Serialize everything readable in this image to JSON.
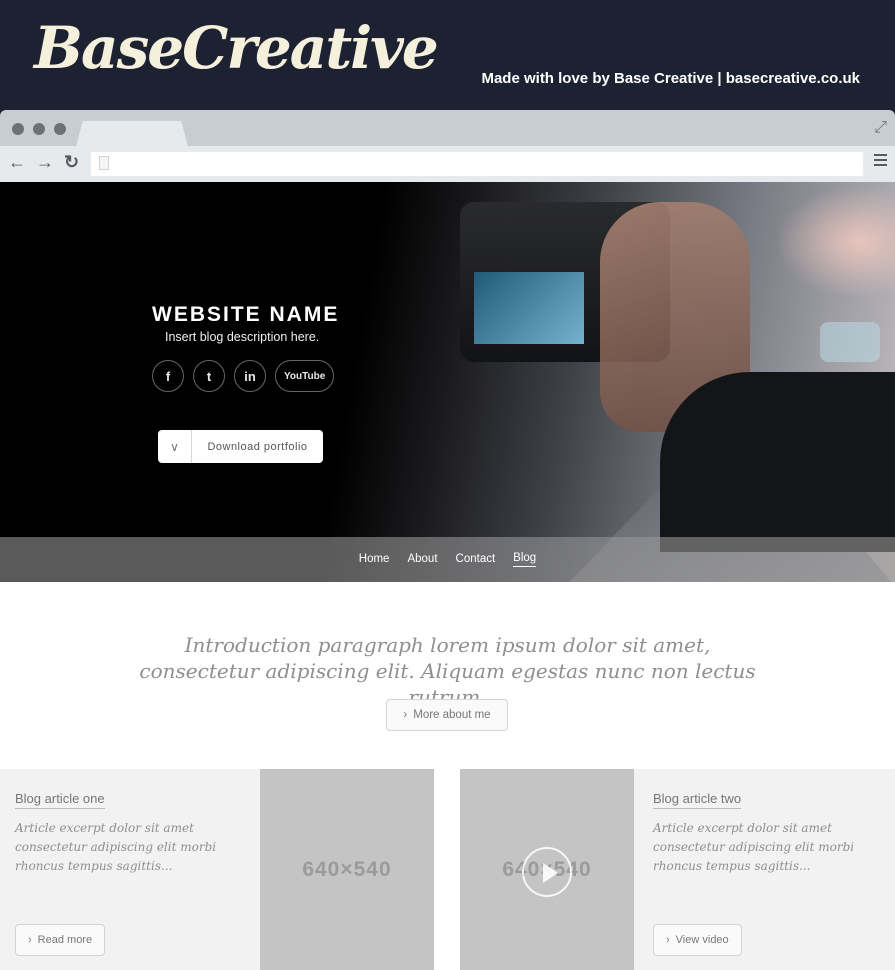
{
  "promo": {
    "logo": "BaseCreative",
    "tagline": "Made with love by Base Creative  |  basecreative.co.uk"
  },
  "browser": {
    "icons": [
      "back-arrow-icon",
      "forward-arrow-icon",
      "reload-icon",
      "page-icon",
      "menu-icon",
      "expand-icon"
    ]
  },
  "hero": {
    "title": "WEBSITE NAME",
    "description": "Insert blog description here.",
    "social": [
      "f",
      "t",
      "in",
      "YouTube"
    ],
    "download_label": "Download portfolio"
  },
  "nav": {
    "items": [
      "Home",
      "About",
      "Contact",
      "Blog"
    ],
    "active": "Blog"
  },
  "intro": {
    "text": "Introduction paragraph lorem ipsum dolor sit amet, consectetur adipiscing elit. Aliquam egestas nunc non lectus rutrum.",
    "button": "More about me"
  },
  "articles": [
    {
      "title": "Blog article one",
      "excerpt": "Article excerpt dolor sit amet consectetur adipiscing elit morbi rhoncus tempus sagittis...",
      "button": "Read more",
      "image": "640×540"
    },
    {
      "title": "Blog article two",
      "excerpt": "Article excerpt dolor sit amet consectetur adipiscing elit morbi rhoncus tempus sagittis...",
      "button": "View video",
      "image": "640×540"
    }
  ]
}
